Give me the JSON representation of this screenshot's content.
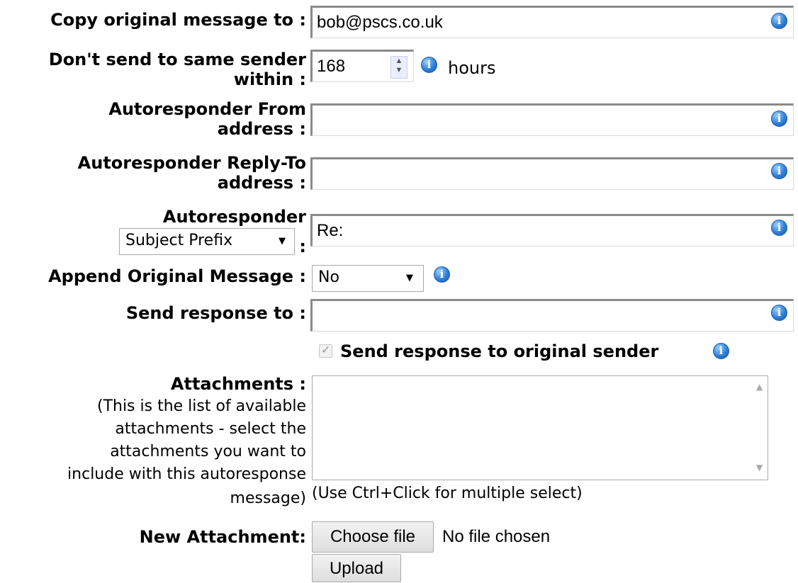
{
  "form": {
    "copy_to_label": "Copy original message to :",
    "copy_to_value": "bob@pscs.co.uk",
    "same_sender_label_1": "Don't send to same sender",
    "same_sender_label_2": "within :",
    "same_sender_value": "168",
    "same_sender_unit": "hours",
    "from_label_1": "Autoresponder From",
    "from_label_2": "address :",
    "from_value": "",
    "replyto_label_1": "Autoresponder Reply-To",
    "replyto_label_2": "address :",
    "replyto_value": "",
    "subject_label": "Autoresponder",
    "subject_mode_selected": "Subject Prefix",
    "subject_colon": ":",
    "subject_value": "Re:",
    "append_label": "Append Original Message :",
    "append_selected": "No",
    "send_to_label": "Send response to :",
    "send_to_value": "",
    "send_to_original_label": "Send response to original sender",
    "send_to_original_checked": true,
    "attachments_label": "Attachments :",
    "attachments_help_1": "(This is the list of available",
    "attachments_help_2": "attachments - select the",
    "attachments_help_3": "attachments you want to",
    "attachments_help_4": "include with this autoresponse",
    "attachments_help_5": "message)",
    "attachments_hint": "(Use Ctrl+Click for multiple select)",
    "new_attachment_label": "New Attachment:",
    "choose_file_button": "Choose file",
    "no_file_text": "No file chosen",
    "upload_button": "Upload"
  },
  "icons": {
    "info": "info-icon",
    "dropdown": "triangle-down-icon",
    "spinner": "up-down-spinner-icon",
    "checkbox": "checkmark-icon"
  },
  "colors": {
    "info_icon": "#2f7fd6",
    "field_border": "#8a8a8a",
    "background": "#ffffff"
  }
}
